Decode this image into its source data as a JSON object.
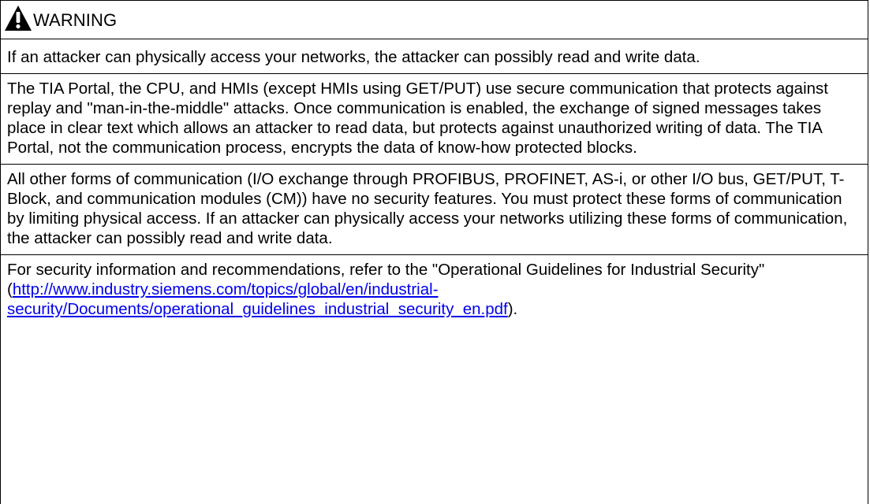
{
  "notice": {
    "icon": "warning-triangle-icon",
    "signal_word": "WARNING",
    "lead": "If an attacker can physically access your networks, the attacker can possibly read and write data.",
    "paragraph_1": "The TIA Portal, the CPU, and HMIs (except HMIs using GET/PUT) use secure communication that protects against replay and \"man-in-the-middle\" attacks. Once communication is enabled, the exchange of signed messages takes place in clear text which allows an attacker to read data, but protects against unauthorized writing of data. The TIA Portal, not the communication process, encrypts the data of know-how protected blocks.",
    "paragraph_2": "All other forms of communication (I/O exchange through PROFIBUS, PROFINET, AS-i, or other I/O bus, GET/PUT, T-Block, and communication modules (CM)) have no security features. You must protect these forms of communication by limiting physical access. If an attacker can physically access your networks utilizing these forms of communication, the attacker can possibly read and write data.",
    "paragraph_3_prefix": "For security information and recommendations, refer to the \"Operational Guidelines for Industrial Security\" (",
    "paragraph_3_link": "http://www.industry.siemens.com/topics/global/en/industrial-security/Documents/operational_guidelines_industrial_security_en.pdf",
    "paragraph_3_suffix": ").",
    "colors": {
      "border": "#000000",
      "icon_fill": "#000000",
      "link": "#0000ee"
    }
  }
}
